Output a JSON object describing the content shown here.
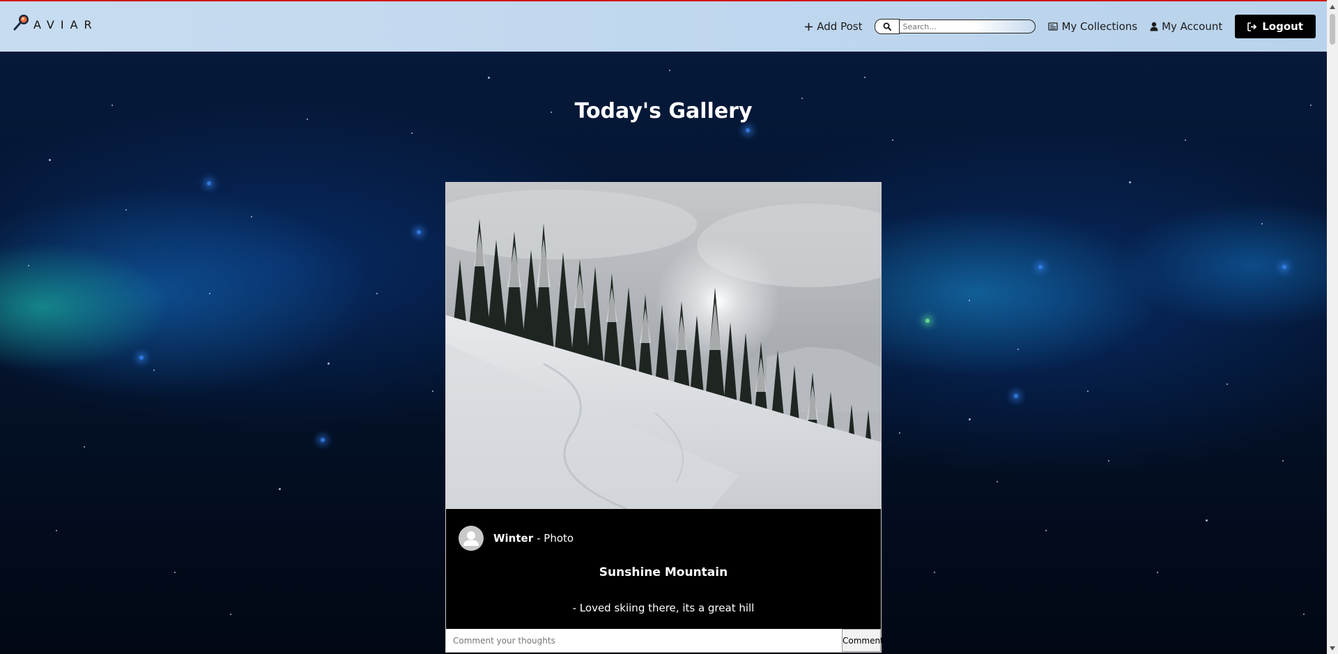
{
  "header": {
    "brand": "AVIAR",
    "nav": {
      "add_post": "Add Post",
      "search_placeholder": "Search...",
      "my_collections": "My Collections",
      "my_account": "My Account",
      "logout": "Logout"
    }
  },
  "main": {
    "title": "Today's Gallery",
    "post": {
      "author": "Winter",
      "type_separator": "- Photo",
      "title": "Sunshine Mountain",
      "description": "- Loved skiing there, its a great hill",
      "comment_placeholder": "Comment your thoughts",
      "comment_button": "Comment"
    }
  },
  "colors": {
    "header_bg": "#c3d9ef",
    "top_accent": "#d11a1a",
    "logout_bg": "#000000",
    "card_bg": "#000000"
  }
}
